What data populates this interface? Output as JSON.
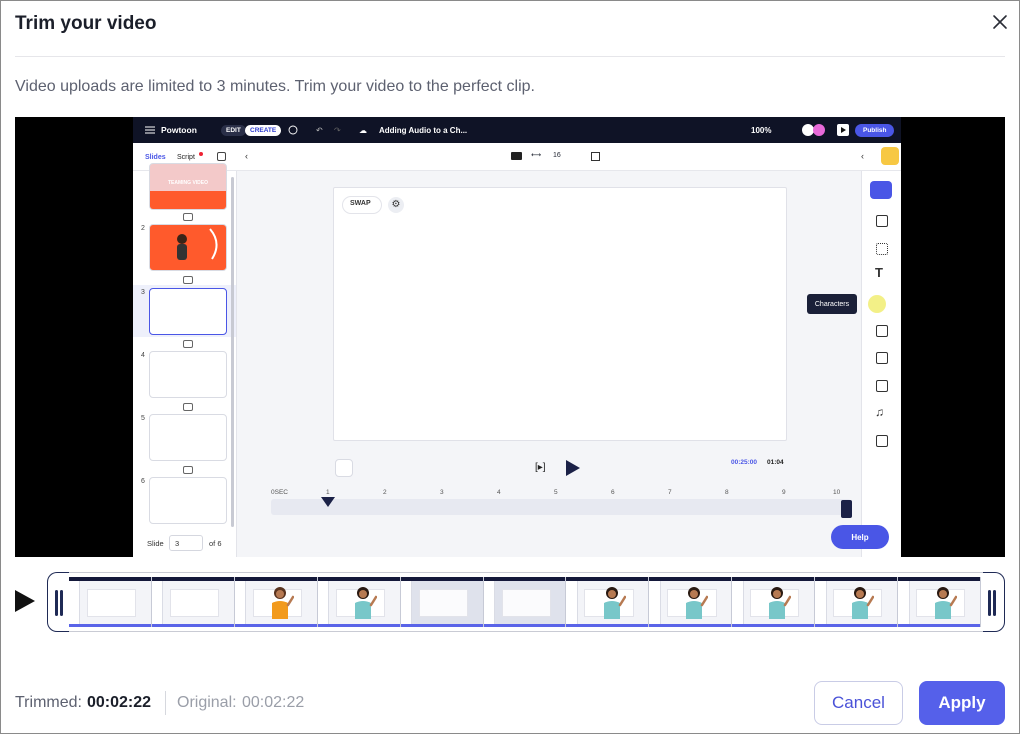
{
  "dialog": {
    "title": "Trim your video",
    "subtitle": "Video uploads are limited to 3 minutes. Trim your video to the perfect clip."
  },
  "preview": {
    "brand": "Powtoon",
    "mode_edit": "EDIT",
    "mode_create": "CREATE",
    "doc_title": "Adding Audio to a Ch...",
    "zoom": "100%",
    "publish_label": "Publish",
    "tab_slides": "Slides",
    "tab_script": "Script",
    "aspect_value": "16",
    "thumb1_text": "TEAMING VIDEO",
    "slide_numbers": [
      "2",
      "3",
      "4",
      "5",
      "6"
    ],
    "slide_label": "Slide",
    "slide_current": "3",
    "slide_total": "of 6",
    "swap_label": "SWAP",
    "time_current": "00:25:00",
    "time_total": "01:04",
    "ruler_start": "0SEC",
    "ruler_ticks": [
      "1",
      "2",
      "3",
      "4",
      "5",
      "6",
      "7",
      "8",
      "9",
      "10"
    ],
    "tooltip": "Characters",
    "help_label": "Help"
  },
  "timeline": {
    "frame_count": 11,
    "selected_frames": [
      4,
      5
    ]
  },
  "footer": {
    "trimmed_label": "Trimmed:",
    "trimmed_value": "00:02:22",
    "original_label": "Original:",
    "original_value": "00:02:22"
  },
  "buttons": {
    "cancel": "Cancel",
    "apply": "Apply"
  },
  "colors": {
    "accent": "#5560ea",
    "cancel_text": "#4a52d8",
    "handle": "#1f2a55"
  }
}
